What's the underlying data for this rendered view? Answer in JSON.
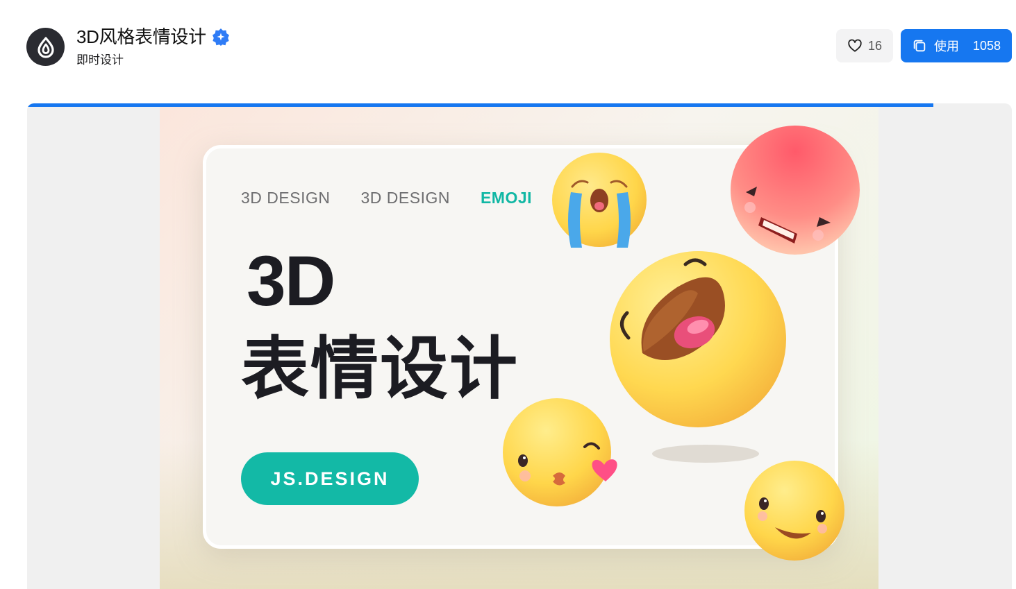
{
  "header": {
    "title": "3D风格表情设计",
    "author": "即时设计",
    "like_count": "16",
    "use_label": "使用",
    "use_count": "1058"
  },
  "preview": {
    "progress_fraction": 0.92,
    "tags": [
      "3D DESIGN",
      "3D DESIGN",
      "EMOJI"
    ],
    "headline_line1": "3D",
    "headline_line2": "表情设计",
    "pill_label": "JS.DESIGN"
  },
  "colors": {
    "accent_blue": "#1677f0",
    "accent_teal": "#13b9a6",
    "emoji_yellow": "#ffd84a",
    "emoji_red": "#ff6b74"
  },
  "icons": {
    "avatar": "droplet-logo-icon",
    "verified": "verified-badge-icon",
    "like": "heart-icon",
    "use": "copy-icon"
  }
}
